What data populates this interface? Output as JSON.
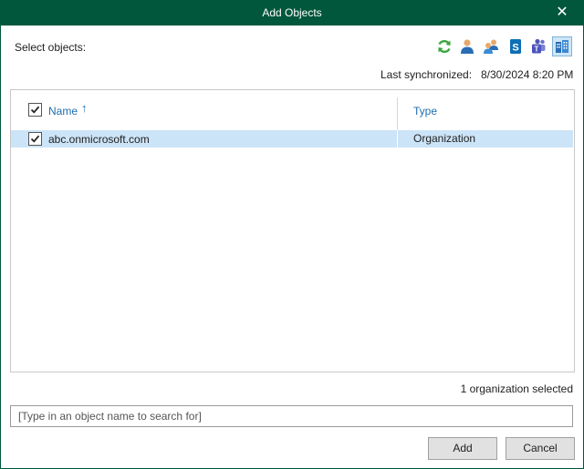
{
  "window": {
    "title": "Add Objects"
  },
  "header": {
    "select_label": "Select objects:",
    "toolbar_icons": [
      "refresh-icon",
      "user-icon",
      "group-icon",
      "sharepoint-icon",
      "teams-icon",
      "organization-icon"
    ],
    "active_icon": "organization-icon",
    "sync_label": "Last synchronized:",
    "sync_value": "8/30/2024 8:20 PM"
  },
  "grid": {
    "columns": [
      "Name",
      "Type"
    ],
    "sort_indicator": "↑",
    "rows": [
      {
        "name": "abc.onmicrosoft.com",
        "type": "Organization",
        "checked": true
      }
    ]
  },
  "status": "1 organization selected",
  "search": {
    "placeholder": "[Type in an object name to search for]"
  },
  "buttons": {
    "add": "Add",
    "cancel": "Cancel"
  },
  "colors": {
    "titlebar": "#00573c",
    "selection": "#cce4f7",
    "link": "#1e6eb0"
  }
}
